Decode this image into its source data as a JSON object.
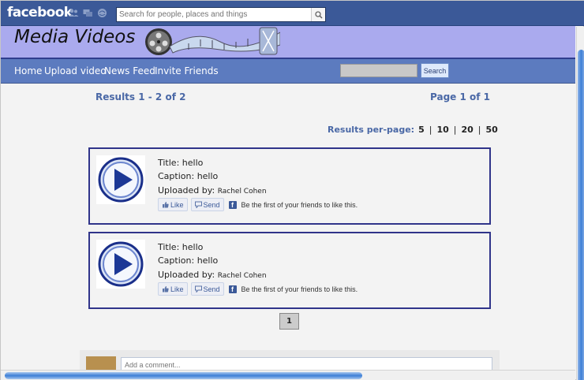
{
  "fb": {
    "logo": "facebook",
    "search_placeholder": "Search for people, places and things"
  },
  "banner": {
    "title": "Media Videos"
  },
  "nav": {
    "items": [
      "Home",
      "Upload video",
      "News Feed",
      "Invite Friends"
    ],
    "search_button": "Search"
  },
  "results": {
    "count": "Results 1 - 2 of 2",
    "page_info": "Page 1 of 1",
    "per_page_label": "Results per-page:",
    "per_page_options": [
      "5",
      "10",
      "20",
      "50"
    ]
  },
  "videos": [
    {
      "title_label": "Title:",
      "title": "hello",
      "caption_label": "Caption:",
      "caption": "hello",
      "uploader_label": "Uploaded by:",
      "uploader": "Rachel Cohen",
      "like_label": "Like",
      "send_label": "Send",
      "like_text": "Be the first of your friends to like this."
    },
    {
      "title_label": "Title:",
      "title": "hello",
      "caption_label": "Caption:",
      "caption": "hello",
      "uploader_label": "Uploaded by:",
      "uploader": "Rachel Cohen",
      "like_label": "Like",
      "send_label": "Send",
      "like_text": "Be the first of your friends to like this."
    }
  ],
  "pagination": {
    "current": "1"
  },
  "comments": {
    "placeholder": "Add a comment..."
  },
  "icons": {
    "fb_icons": [
      "friend-requests-icon",
      "messages-icon",
      "notifications-icon"
    ],
    "play": "play-icon"
  },
  "colors": {
    "fb_blue": "#3b5998",
    "banner": "#aaaaee",
    "nav": "#5c7bbf",
    "card_border": "#30348a"
  }
}
